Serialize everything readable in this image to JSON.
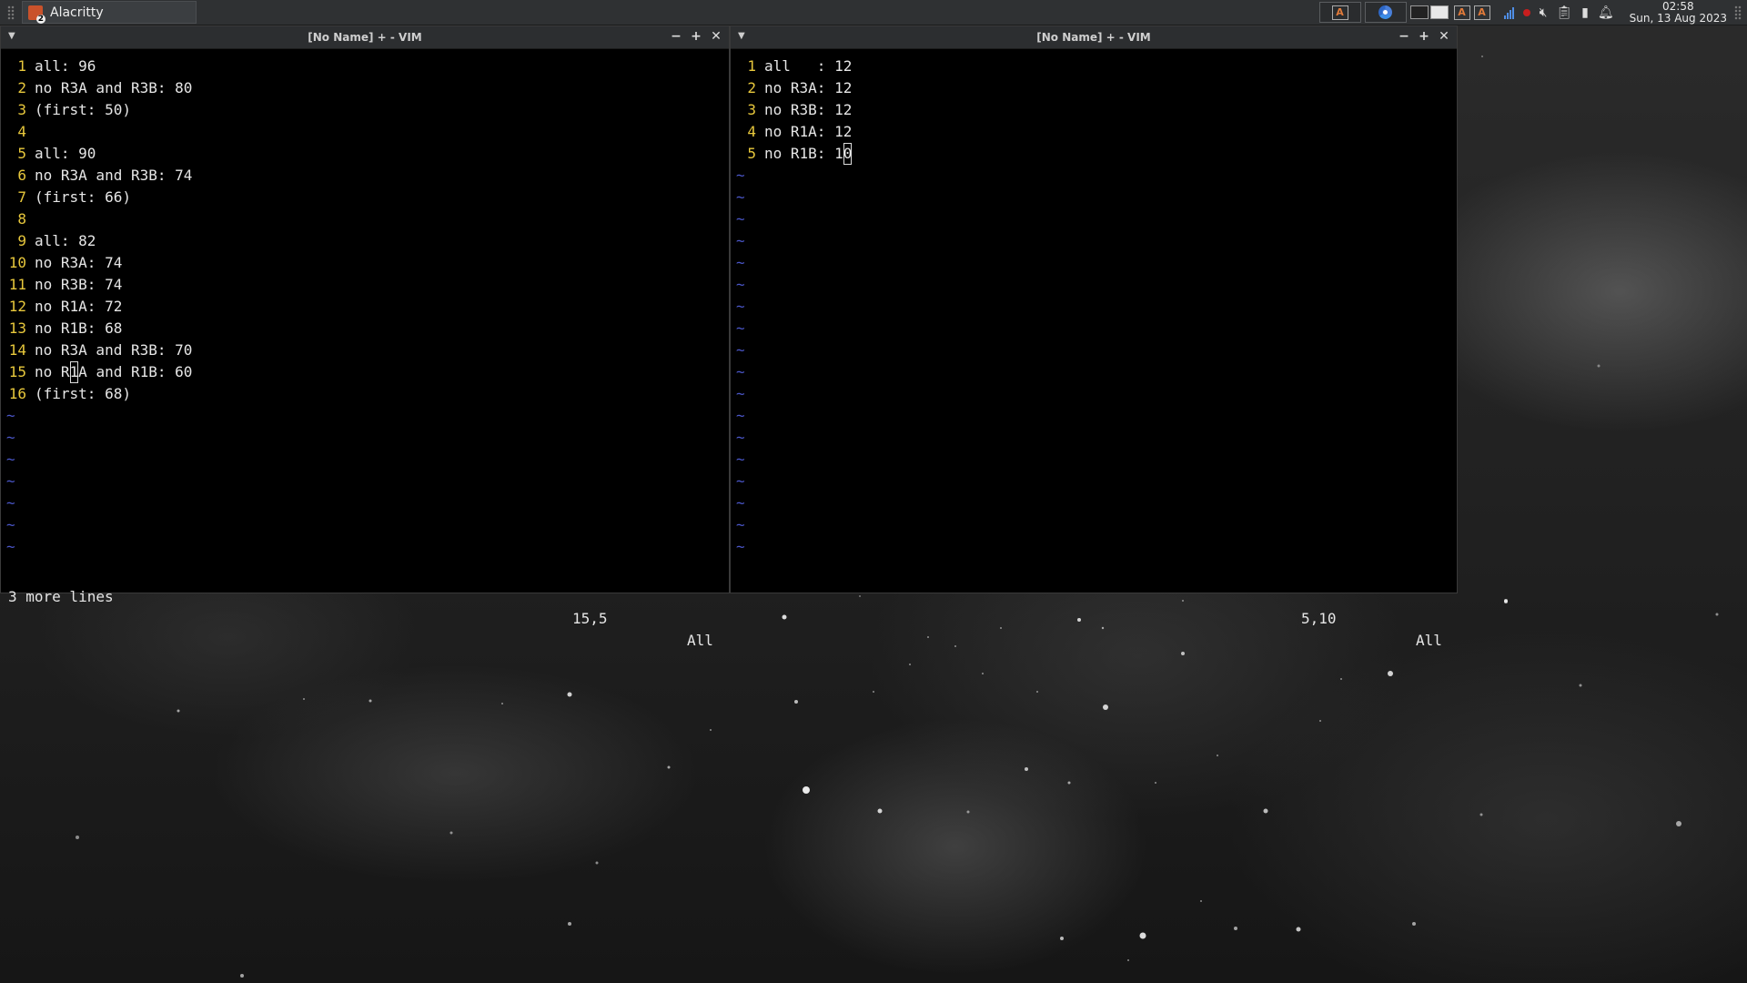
{
  "taskbar": {
    "app_name": "Alacritty",
    "app_badge": "2",
    "app_icon_letter": "A",
    "clock_time": "02:58",
    "clock_date": "Sun, 13 Aug 2023"
  },
  "left_window": {
    "title": "[No Name] + - VIM",
    "lines": [
      {
        "n": "1",
        "t": "all: 96"
      },
      {
        "n": "2",
        "t": "no R3A and R3B: 80"
      },
      {
        "n": "3",
        "t": "(first: 50)"
      },
      {
        "n": "4",
        "t": ""
      },
      {
        "n": "5",
        "t": "all: 90"
      },
      {
        "n": "6",
        "t": "no R3A and R3B: 74"
      },
      {
        "n": "7",
        "t": "(first: 66)"
      },
      {
        "n": "8",
        "t": ""
      },
      {
        "n": "9",
        "t": "all: 82"
      },
      {
        "n": "10",
        "t": "no R3A: 74"
      },
      {
        "n": "11",
        "t": "no R3B: 74"
      },
      {
        "n": "12",
        "t": "no R1A: 72"
      },
      {
        "n": "13",
        "t": "no R1B: 68"
      },
      {
        "n": "14",
        "t": "no R3A and R3B: 70"
      },
      {
        "n": "15",
        "t_pre": "no R",
        "t_cursor": "1",
        "t_post": "A and R1B: 60"
      },
      {
        "n": "16",
        "t": "(first: 68)"
      }
    ],
    "status_message": "3 more lines",
    "cursor_position": "15,5",
    "scroll": "All"
  },
  "right_window": {
    "title": "[No Name] + - VIM",
    "lines": [
      {
        "n": "1",
        "t": "all   : 12"
      },
      {
        "n": "2",
        "t": "no R3A: 12"
      },
      {
        "n": "3",
        "t": "no R3B: 12"
      },
      {
        "n": "4",
        "t": "no R1A: 12"
      },
      {
        "n": "5",
        "t_pre": "no R1B: 1",
        "t_cursor": "0",
        "t_post": ""
      }
    ],
    "status_message": "",
    "cursor_position": "5,10",
    "scroll": "All"
  },
  "tilde": "~",
  "colors": {
    "line_number": "#e8c83c",
    "tilde": "#4a56c8",
    "terminal_bg": "#000000",
    "text": "#e6e6e6"
  }
}
